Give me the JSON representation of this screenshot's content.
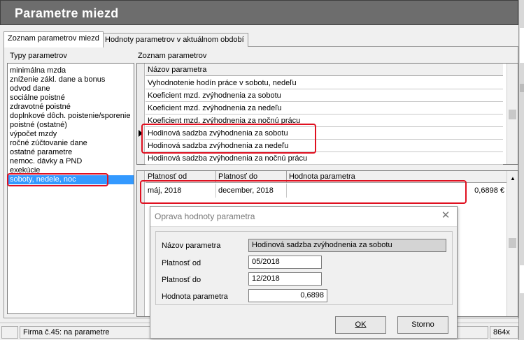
{
  "window": {
    "title": "Parametre miezd"
  },
  "tabs": [
    "Zoznam parametrov miezd",
    "Hodnoty parametrov v aktuálnom období"
  ],
  "left_panel": {
    "label": "Typy parametrov",
    "items": [
      "minimálna mzda",
      "zníženie zákl. dane a bonus",
      "odvod dane",
      "sociálne poistné",
      "zdravotné poistné",
      "doplnkové dôch. poistenie/sporenie",
      "poistné (ostatné)",
      "výpočet mzdy",
      "ročné zúčtovanie dane",
      "ostatné parametre",
      "nemoc. dávky a PND",
      "exekúcie",
      "soboty, nedele, noc"
    ],
    "selected_index": 12
  },
  "param_list": {
    "label": "Zoznam parametrov",
    "column": "Názov parametra",
    "rows": [
      "Vyhodnotenie hodín práce v sobotu, nedeľu",
      "Koeficient mzd. zvýhodnenia za sobotu",
      "Koeficient mzd. zvýhodnenia za nedeľu",
      "Koeficient mzd. zvýhodnenia za nočnú prácu",
      "Hodinová sadzba zvýhodnenia za sobotu",
      "Hodinová sadzba zvýhodnenia za nedeľu",
      "Hodinová sadzba zvýhodnenia za nočnú prácu"
    ],
    "current_index": 4
  },
  "values_grid": {
    "columns": [
      "Platnosť od",
      "Platnosť do",
      "Hodnota parametra"
    ],
    "rows": [
      {
        "from": "máj, 2018",
        "to": "december, 2018",
        "value": "0,6898 €"
      }
    ]
  },
  "dialog": {
    "title": "Oprava hodnoty parametra",
    "fields": [
      {
        "label": "Názov parametra",
        "value": "Hodinová sadzba zvýhodnenia za sobotu"
      },
      {
        "label": "Platnosť od",
        "value": "05/2018"
      },
      {
        "label": "Platnosť do",
        "value": "12/2018"
      },
      {
        "label": "Hodnota parametra",
        "value": "0,6898"
      }
    ],
    "ok": "OK",
    "cancel": "Storno"
  },
  "status": {
    "left": "",
    "company": "Firma č.45: na parametre",
    "size": "864x"
  },
  "colors": {
    "selection": "#3399ff",
    "highlight": "#e01020"
  }
}
